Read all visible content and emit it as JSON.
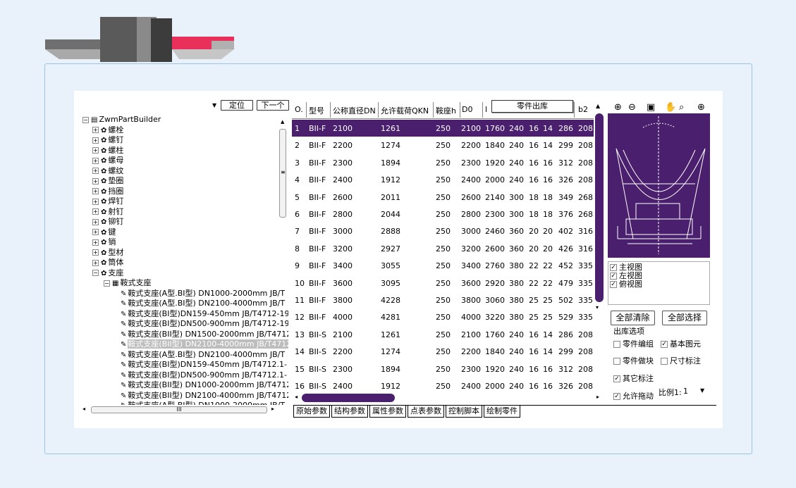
{
  "toolbar": {
    "locate_label": "定位",
    "next_label": "下一个"
  },
  "tree": {
    "root": "ZwmPartBuilder",
    "categories": [
      "螺栓",
      "螺钉",
      "螺柱",
      "螺母",
      "螺纹",
      "垫圈",
      "挡圈",
      "焊钉",
      "射钉",
      "铆钉",
      "键",
      "销",
      "型材",
      "筒体",
      "支座"
    ],
    "sub_category": "鞍式支座",
    "leaves": [
      "鞍式支座(A型.BI型) DN1000-2000mm JB/T",
      "鞍式支座(A型.BI型) DN2100-4000mm JB/T",
      "鞍式支座(BI型)DN159-450mm JB/T4712-19",
      "鞍式支座(BI型)DN500-900mm JB/T4712-19",
      "鞍式支座(BII型) DN1500-2000mm JB/T4712",
      "鞍式支座(BII型) DN2100-4000mm JB/T4712",
      "鞍式支座(A型.BI型) DN2100-4000mm JB/T",
      "鞍式支座(BI型)DN159-450mm JB/T4712.1-",
      "鞍式支座(BI型)DN500-900mm JB/T4712.1-",
      "鞍式支座(BII型) DN1000-2000mm JB/T4712",
      "鞍式支座(BII型) DN2100-4000mm JB/T4712",
      "鞍式支座(A型.BI型) DN1000-2000mm JB/T"
    ],
    "selected_index": 5,
    "hscroll_label": "III"
  },
  "grid": {
    "columns": [
      "O.",
      "型号",
      "公称直径DN",
      "允许载荷QKN",
      "鞍座h",
      "D0",
      "l",
      "",
      "",
      "",
      "",
      "",
      "b2"
    ],
    "popup_label": "零件出库",
    "rows": [
      [
        "1",
        "BII-F",
        "2100",
        "1261",
        "250",
        "2100",
        "1760",
        "240",
        "16",
        "14",
        "286",
        "208"
      ],
      [
        "2",
        "BII-F",
        "2200",
        "1274",
        "250",
        "2200",
        "1840",
        "240",
        "16",
        "14",
        "299",
        "208"
      ],
      [
        "3",
        "BII-F",
        "2300",
        "1894",
        "250",
        "2300",
        "1920",
        "240",
        "16",
        "16",
        "312",
        "208"
      ],
      [
        "4",
        "BII-F",
        "2400",
        "1912",
        "250",
        "2400",
        "2000",
        "240",
        "16",
        "16",
        "326",
        "208"
      ],
      [
        "5",
        "BII-F",
        "2600",
        "2011",
        "250",
        "2600",
        "2140",
        "300",
        "18",
        "18",
        "349",
        "268"
      ],
      [
        "6",
        "BII-F",
        "2800",
        "2044",
        "250",
        "2800",
        "2300",
        "300",
        "18",
        "18",
        "376",
        "268"
      ],
      [
        "7",
        "BII-F",
        "3000",
        "2888",
        "250",
        "3000",
        "2460",
        "360",
        "20",
        "20",
        "402",
        "316"
      ],
      [
        "8",
        "BII-F",
        "3200",
        "2927",
        "250",
        "3200",
        "2600",
        "360",
        "20",
        "20",
        "426",
        "316"
      ],
      [
        "9",
        "BII-F",
        "3400",
        "3055",
        "250",
        "3400",
        "2760",
        "380",
        "22",
        "22",
        "452",
        "335"
      ],
      [
        "10",
        "BII-F",
        "3600",
        "3095",
        "250",
        "3600",
        "2920",
        "380",
        "22",
        "22",
        "479",
        "335"
      ],
      [
        "11",
        "BII-F",
        "3800",
        "4228",
        "250",
        "3800",
        "3060",
        "380",
        "25",
        "25",
        "502",
        "335"
      ],
      [
        "12",
        "BII-F",
        "4000",
        "4281",
        "250",
        "4000",
        "3220",
        "380",
        "25",
        "25",
        "529",
        "335"
      ],
      [
        "13",
        "BII-S",
        "2100",
        "1261",
        "250",
        "2100",
        "1760",
        "240",
        "16",
        "14",
        "286",
        "208"
      ],
      [
        "14",
        "BII-S",
        "2200",
        "1274",
        "250",
        "2200",
        "1840",
        "240",
        "16",
        "14",
        "299",
        "208"
      ],
      [
        "15",
        "BII-S",
        "2300",
        "1894",
        "250",
        "2300",
        "1920",
        "240",
        "16",
        "16",
        "312",
        "208"
      ],
      [
        "16",
        "BII-S",
        "2400",
        "1912",
        "250",
        "2400",
        "2000",
        "240",
        "16",
        "16",
        "326",
        "208"
      ]
    ],
    "highlight_color": "#4a1f6e"
  },
  "tabs": [
    "原始参数",
    "结构参数",
    "属性参数",
    "点表参数",
    "控制脚本",
    "绘制零件"
  ],
  "right": {
    "views": [
      "主视图",
      "左视图",
      "俯视图"
    ],
    "clear_all": "全部清除",
    "select_all": "全部选择",
    "options_title": "出库选项",
    "opt_group": "零件编组",
    "opt_basic": "基本图元",
    "opt_block": "零件做块",
    "opt_dim": "尺寸标注",
    "opt_other": "其它标注",
    "opt_drag": "允许拖动",
    "scale_label": "比例1:",
    "scale_value": "1"
  }
}
